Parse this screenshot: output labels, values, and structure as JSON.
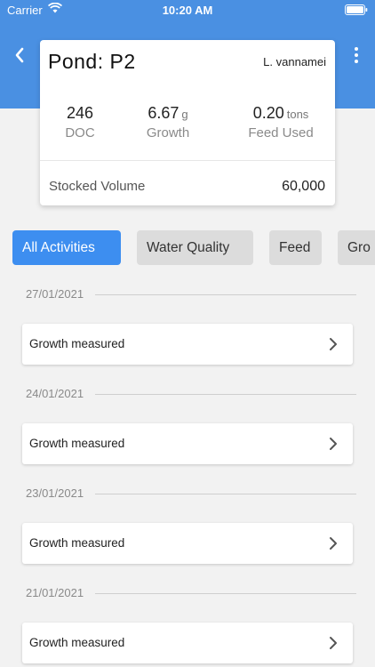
{
  "status_bar": {
    "carrier": "Carrier",
    "time": "10:20 AM"
  },
  "header": {
    "back_icon": "chevron-left-icon",
    "menu_icon": "more-vertical-icon",
    "color": "#4a90e2"
  },
  "pond": {
    "title": "Pond: P2",
    "species": "L. vannamei",
    "stats": {
      "doc": {
        "value": "246",
        "label": "DOC"
      },
      "growth": {
        "value": "6.67",
        "unit": "g",
        "label": "Growth"
      },
      "feed": {
        "value": "0.20",
        "unit": "tons",
        "label": "Feed Used"
      }
    },
    "stocked_label": "Stocked Volume",
    "stocked_value": "60,000"
  },
  "filters": {
    "active_color": "#3d8ef0",
    "items": [
      {
        "label": "All Activities",
        "active": true
      },
      {
        "label": "Water Quality",
        "active": false
      },
      {
        "label": "Feed",
        "active": false
      },
      {
        "label": "Gro",
        "active": false
      }
    ]
  },
  "activities": [
    {
      "date": "27/01/2021",
      "title": "Growth measured"
    },
    {
      "date": "24/01/2021",
      "title": "Growth measured"
    },
    {
      "date": "23/01/2021",
      "title": "Growth measured"
    },
    {
      "date": "21/01/2021",
      "title": "Growth measured"
    }
  ]
}
